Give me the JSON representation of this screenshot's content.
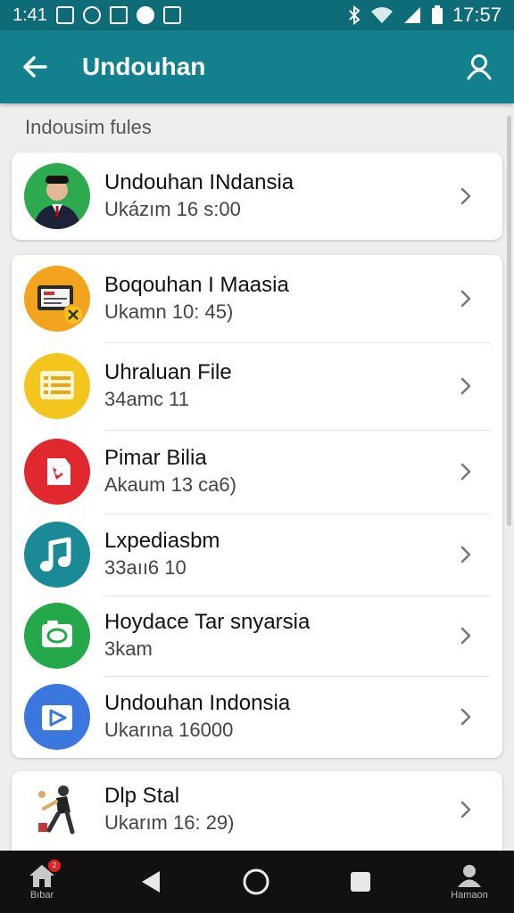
{
  "status_bar": {
    "left_text": "1:41",
    "time": "17:57",
    "icons_left": [
      "image-icon",
      "alarm-icon",
      "cast-icon",
      "whatsapp-icon",
      "file-icon"
    ],
    "icons_right": [
      "bluetooth-icon",
      "wifi-icon",
      "signal-icon",
      "battery-icon"
    ]
  },
  "app_bar": {
    "title": "Undouhan",
    "back_icon": "arrow-left-icon",
    "profile_icon": "person-icon",
    "background": "#12818d"
  },
  "section_label": "Indousim fules",
  "featured": {
    "name": "Undouhan INdansia",
    "sub": "Ukázım 16 s:00",
    "avatar_color": "#2eaa4e",
    "icon": "person-avatar-icon"
  },
  "items": [
    {
      "name": "Boqouhan I Maasia",
      "sub": "Ukamn 10: 45)",
      "avatar_color": "#f2a41f",
      "icon": "document-icon"
    },
    {
      "name": "Uhraluan File",
      "sub": "34amc 11",
      "avatar_color": "#f4c51c",
      "icon": "list-icon"
    },
    {
      "name": "Pimar Bilia",
      "sub": "Akaum 13 ca6)",
      "avatar_color": "#e0282e",
      "icon": "tag-icon"
    },
    {
      "name": "Lxpediasbm",
      "sub": "33aıı6 10",
      "avatar_color": "#1a8a96",
      "icon": "music-note-icon"
    },
    {
      "name": "Hoydace Tar snyarsia",
      "sub": "3kam",
      "avatar_color": "#24a84a",
      "icon": "chat-bubble-icon"
    },
    {
      "name": "Undouhan Indonsia",
      "sub": "Ukarına 16000",
      "avatar_color": "#3a78e0",
      "icon": "play-folder-icon"
    }
  ],
  "last_item": {
    "name": "Dlp Stal",
    "sub": "Ukarım 16: 29)",
    "avatar_color": "#ffffff",
    "icon": "figure-illustration-icon"
  },
  "nav_bar": {
    "home_label": "Bıbar",
    "profile_label": "Hamaon",
    "badge": "2"
  }
}
